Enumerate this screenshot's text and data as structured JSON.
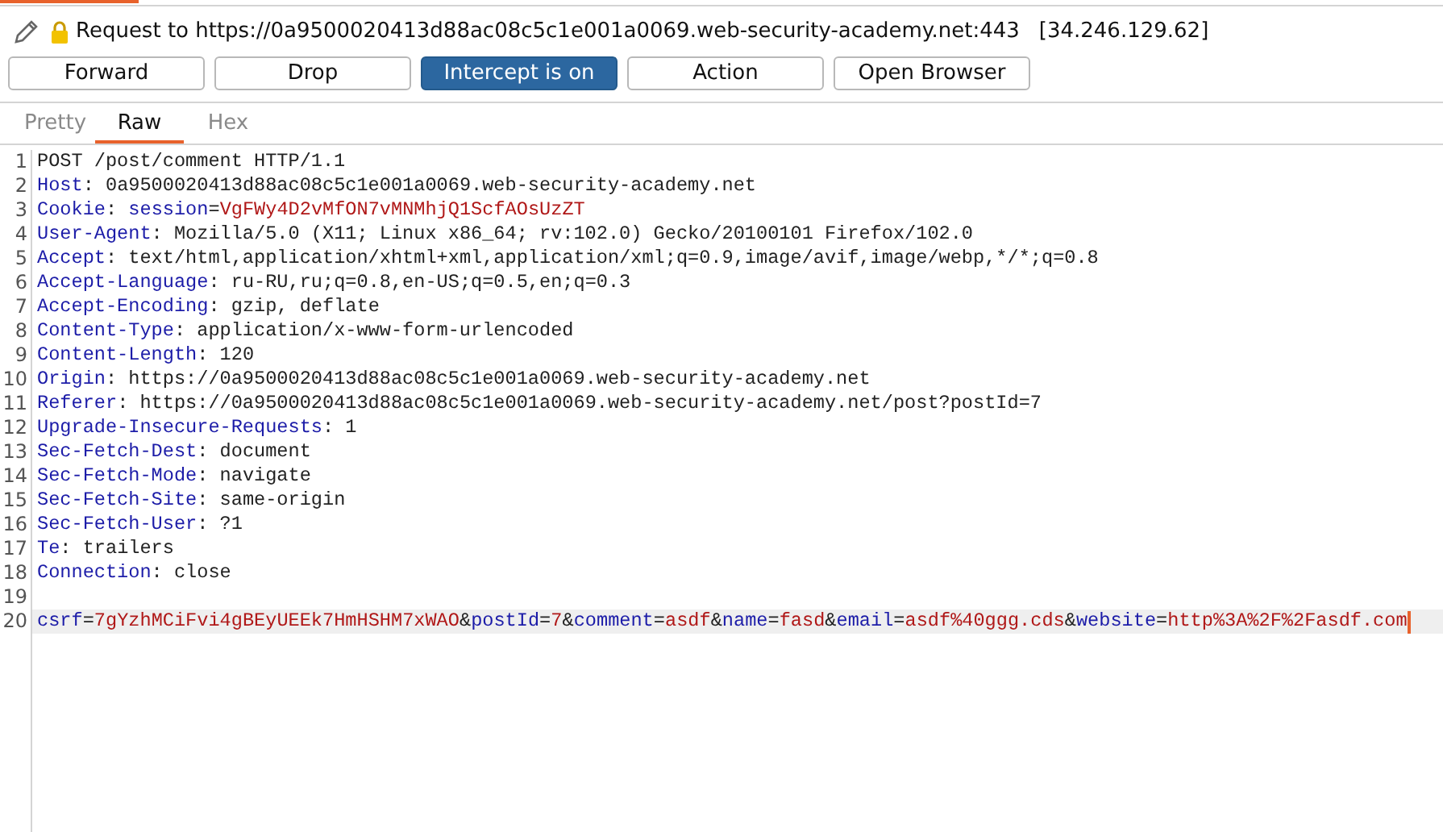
{
  "request_title": {
    "label": "Request to https://0a9500020413d88ac08c5c1e001a0069.web-security-academy.net:443",
    "ip": "[34.246.129.62]"
  },
  "buttons": [
    {
      "label": "Forward",
      "kind": "push"
    },
    {
      "label": "Drop",
      "kind": "push"
    },
    {
      "label": "Intercept is on",
      "kind": "toggle",
      "on": true
    },
    {
      "label": "Action",
      "kind": "push"
    },
    {
      "label": "Open Browser",
      "kind": "push"
    }
  ],
  "tabs": [
    {
      "label": "Pretty",
      "selected": false
    },
    {
      "label": "Raw",
      "selected": true
    },
    {
      "label": "Hex",
      "selected": false
    }
  ],
  "lines": [
    {
      "number": "1",
      "current": false,
      "segments": [
        {
          "kind": "plain",
          "text": "POST /post/comment HTTP/1.1"
        }
      ]
    },
    {
      "number": "2",
      "current": false,
      "segments": [
        {
          "kind": "key",
          "text": "Host"
        },
        {
          "kind": "plain",
          "text": ": 0a9500020413d88ac08c5c1e001a0069.web-security-academy.net"
        }
      ]
    },
    {
      "number": "3",
      "current": false,
      "segments": [
        {
          "kind": "key",
          "text": "Cookie"
        },
        {
          "kind": "plain",
          "text": ": "
        },
        {
          "kind": "key",
          "text": "session"
        },
        {
          "kind": "plain",
          "text": "="
        },
        {
          "kind": "value",
          "text": "VgFWy4D2vMfON7vMNMhjQ1ScfAOsUzZT"
        }
      ]
    },
    {
      "number": "4",
      "current": false,
      "segments": [
        {
          "kind": "key",
          "text": "User-Agent"
        },
        {
          "kind": "plain",
          "text": ": Mozilla/5.0 (X11; Linux x86_64; rv:102.0) Gecko/20100101 Firefox/102.0"
        }
      ]
    },
    {
      "number": "5",
      "current": false,
      "segments": [
        {
          "kind": "key",
          "text": "Accept"
        },
        {
          "kind": "plain",
          "text": ": text/html,application/xhtml+xml,application/xml;q=0.9,image/avif,image/webp,*/*;q=0.8"
        }
      ]
    },
    {
      "number": "6",
      "current": false,
      "segments": [
        {
          "kind": "key",
          "text": "Accept-Language"
        },
        {
          "kind": "plain",
          "text": ": ru-RU,ru;q=0.8,en-US;q=0.5,en;q=0.3"
        }
      ]
    },
    {
      "number": "7",
      "current": false,
      "segments": [
        {
          "kind": "key",
          "text": "Accept-Encoding"
        },
        {
          "kind": "plain",
          "text": ": gzip, deflate"
        }
      ]
    },
    {
      "number": "8",
      "current": false,
      "segments": [
        {
          "kind": "key",
          "text": "Content-Type"
        },
        {
          "kind": "plain",
          "text": ": application/x-www-form-urlencoded"
        }
      ]
    },
    {
      "number": "9",
      "current": false,
      "segments": [
        {
          "kind": "key",
          "text": "Content-Length"
        },
        {
          "kind": "plain",
          "text": ": 120"
        }
      ]
    },
    {
      "number": "10",
      "current": false,
      "segments": [
        {
          "kind": "key",
          "text": "Origin"
        },
        {
          "kind": "plain",
          "text": ": https://0a9500020413d88ac08c5c1e001a0069.web-security-academy.net"
        }
      ]
    },
    {
      "number": "11",
      "current": false,
      "segments": [
        {
          "kind": "key",
          "text": "Referer"
        },
        {
          "kind": "plain",
          "text": ": https://0a9500020413d88ac08c5c1e001a0069.web-security-academy.net/post?postId=7"
        }
      ]
    },
    {
      "number": "12",
      "current": false,
      "segments": [
        {
          "kind": "key",
          "text": "Upgrade-Insecure-Requests"
        },
        {
          "kind": "plain",
          "text": ": 1"
        }
      ]
    },
    {
      "number": "13",
      "current": false,
      "segments": [
        {
          "kind": "key",
          "text": "Sec-Fetch-Dest"
        },
        {
          "kind": "plain",
          "text": ": document"
        }
      ]
    },
    {
      "number": "14",
      "current": false,
      "segments": [
        {
          "kind": "key",
          "text": "Sec-Fetch-Mode"
        },
        {
          "kind": "plain",
          "text": ": navigate"
        }
      ]
    },
    {
      "number": "15",
      "current": false,
      "segments": [
        {
          "kind": "key",
          "text": "Sec-Fetch-Site"
        },
        {
          "kind": "plain",
          "text": ": same-origin"
        }
      ]
    },
    {
      "number": "16",
      "current": false,
      "segments": [
        {
          "kind": "key",
          "text": "Sec-Fetch-User"
        },
        {
          "kind": "plain",
          "text": ": ?1"
        }
      ]
    },
    {
      "number": "17",
      "current": false,
      "segments": [
        {
          "kind": "key",
          "text": "Te"
        },
        {
          "kind": "plain",
          "text": ": trailers"
        }
      ]
    },
    {
      "number": "18",
      "current": false,
      "segments": [
        {
          "kind": "key",
          "text": "Connection"
        },
        {
          "kind": "plain",
          "text": ": close"
        }
      ]
    },
    {
      "number": "19",
      "current": false
    },
    {
      "number": "20",
      "current": true,
      "segments": [
        {
          "kind": "key",
          "text": "csrf"
        },
        {
          "kind": "plain",
          "text": "="
        },
        {
          "kind": "value",
          "text": "7gYzhMCiFvi4gBEyUEEk7HmHSHM7xWAO"
        },
        {
          "kind": "plain",
          "text": "&"
        },
        {
          "kind": "key",
          "text": "postId"
        },
        {
          "kind": "plain",
          "text": "="
        },
        {
          "kind": "value",
          "text": "7"
        },
        {
          "kind": "plain",
          "text": "&"
        },
        {
          "kind": "key",
          "text": "comment"
        },
        {
          "kind": "plain",
          "text": "="
        },
        {
          "kind": "value",
          "text": "asdf"
        },
        {
          "kind": "plain",
          "text": "&"
        },
        {
          "kind": "key",
          "text": "name"
        },
        {
          "kind": "plain",
          "text": "="
        },
        {
          "kind": "value",
          "text": "fasd"
        },
        {
          "kind": "plain",
          "text": "&"
        },
        {
          "kind": "key",
          "text": "email"
        },
        {
          "kind": "plain",
          "text": "="
        },
        {
          "kind": "value",
          "text": "asdf%40ggg.cds"
        },
        {
          "kind": "plain",
          "text": "&"
        },
        {
          "kind": "key",
          "text": "website"
        },
        {
          "kind": "plain",
          "text": "="
        },
        {
          "kind": "value",
          "text": "http%3A%2F%2Fasdf.com"
        }
      ]
    }
  ]
}
